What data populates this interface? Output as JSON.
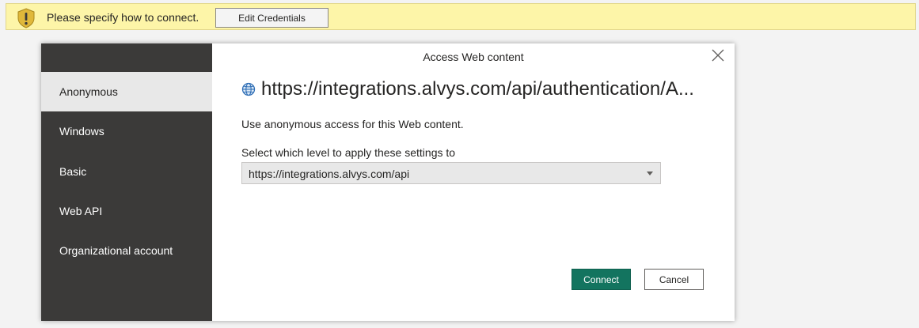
{
  "warning_bar": {
    "icon": "warning-shield-icon",
    "message": "Please specify how to connect.",
    "edit_button_label": "Edit Credentials",
    "background_color": "#fdf5a8"
  },
  "dialog": {
    "title": "Access Web content",
    "close_icon": "close-icon",
    "sidebar": {
      "items": [
        {
          "label": "Anonymous",
          "selected": true
        },
        {
          "label": "Windows",
          "selected": false
        },
        {
          "label": "Basic",
          "selected": false
        },
        {
          "label": "Web API",
          "selected": false
        },
        {
          "label": "Organizational account",
          "selected": false
        }
      ],
      "background_color": "#3b3a39"
    },
    "url_icon": "globe-icon",
    "url": "https://integrations.alvys.com/api/authentication/A...",
    "description": "Use anonymous access for this Web content.",
    "level_label": "Select which level to apply these settings to",
    "level_selected": "https://integrations.alvys.com/api",
    "connect_label": "Connect",
    "cancel_label": "Cancel",
    "accent_color": "#13745f"
  }
}
